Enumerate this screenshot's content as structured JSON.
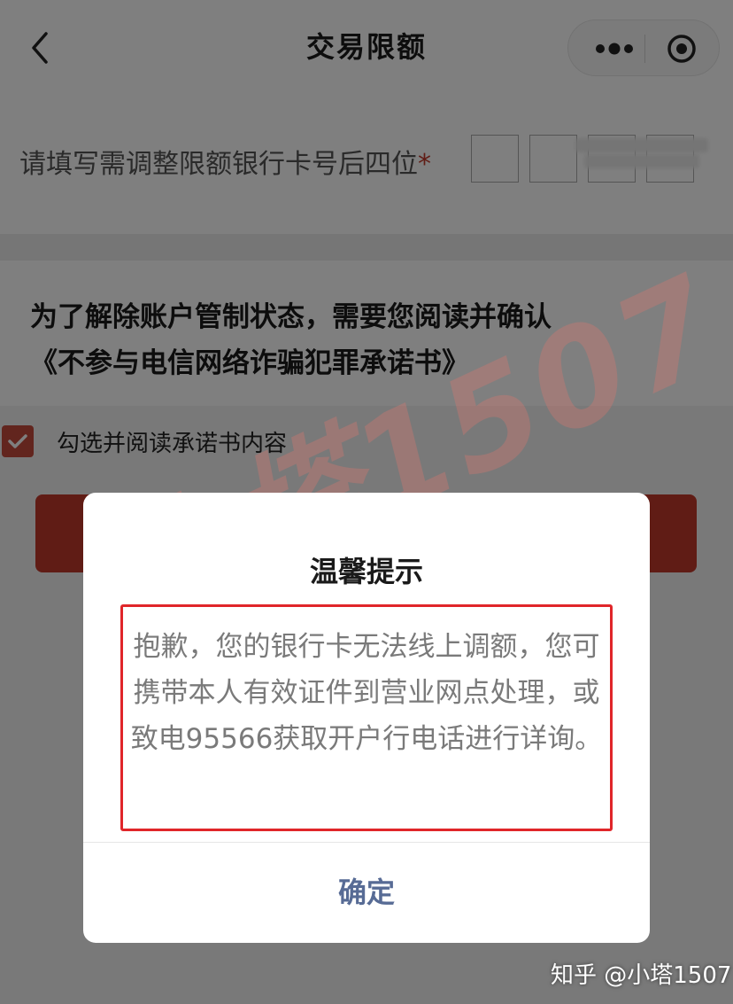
{
  "header": {
    "title": "交易限额",
    "back_icon": "chevron-left-icon",
    "more_icon": "more-dots-icon",
    "close_icon": "target-close-icon"
  },
  "card_input": {
    "label": "请填写需调整限额银行卡号后四位",
    "required_mark": "*"
  },
  "notice": {
    "line1": "为了解除账户管制状态，需要您阅读并确认",
    "line2": "《不参与电信网络诈骗犯罪承诺书》"
  },
  "agreement": {
    "checked": true,
    "label": "勾选并阅读承诺书内容"
  },
  "dialog": {
    "title": "温馨提示",
    "message": "抱歉，您的银行卡无法线上调额，您可携带本人有效证件到营业网点处理，或致电95566获取开户行电话进行详询。",
    "confirm_label": "确定"
  },
  "watermarks": {
    "diagonal": "小塔1507",
    "footer": "知乎 @小塔1507"
  },
  "colors": {
    "accent_red": "#c0392b",
    "highlight_red": "#e0262a",
    "confirm_blue": "#576b95"
  }
}
